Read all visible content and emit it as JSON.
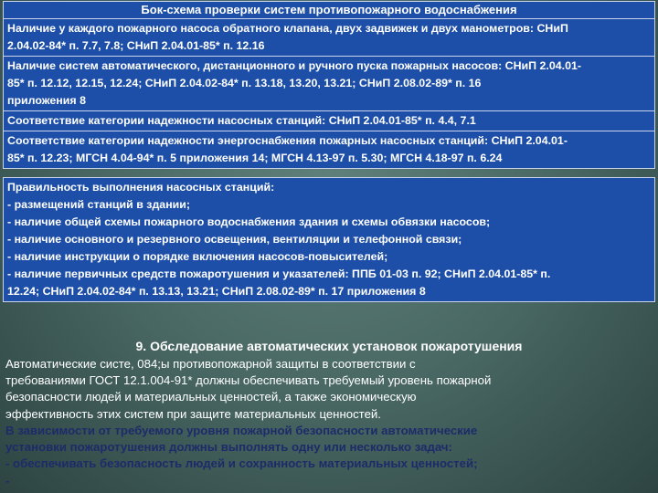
{
  "flowchart": {
    "title": "Бок-схема проверки систем противопожарного водоснабжения",
    "blocks": [
      {
        "lines": [
          "Наличие у каждого пожарного насоса обратного клапана, двух задвижек и двух манометров: СНиП",
          "2.04.02-84* п. 7.7, 7.8; СНиП 2.04.01-85* п. 12.16"
        ]
      },
      {
        "lines": [
          "Наличие систем автоматического, дистанционного и ручного пуска пожарных насосов: СНиП 2.04.01-",
          "85* п. 12.12, 12.15, 12.24; СНиП 2.04.02-84* п. 13.18, 13.20, 13.21; СНиП 2.08.02-89* п. 16",
          "приложения 8"
        ]
      },
      {
        "lines": [
          "Соответствие категории надежности насосных станций: СНиП 2.04.01-85* п. 4.4, 7.1"
        ]
      },
      {
        "lines": [
          "Соответствие категории надежности энергоснабжения пожарных насосных станций: СНиП 2.04.01-",
          "85* п. 12.23; МГСН 4.04-94* п. 5 приложения 14; МГСН 4.13-97 п. 5.30; МГСН 4.18-97 п. 6.24"
        ]
      },
      {
        "lines": [
          "Правильность выполнения насосных станций:",
          "- размещений станций в здании;",
          "- наличие общей схемы пожарного водоснабжения здания и схемы обвязки насосов;",
          "- наличие основного и резервного освещения, вентиляции и телефонной связи;",
          "- наличие инструкции о порядке включения насосов-повысителей;",
          "- наличие первичных средств пожаротушения и указателей: ППБ 01-03 п. 92; СНиП 2.04.01-85* п.",
          "12.24; СНиП 2.04.02-84* п. 13.13, 13.21; СНиП 2.08.02-89* п. 17 приложения 8"
        ]
      }
    ]
  },
  "section": {
    "title": "9. Обследование автоматических установок пожаротушения",
    "paragraph1": [
      " Автоматические систе, 084;ы противопожарной защиты в соответствии с",
      "требованиями ГОСТ 12.1.004-91* должны обеспечивать требуемый уровень пожарной",
      "безопасности людей и материальных ценностей, а также экономическую",
      "эффективность этих систем при защите материальных ценностей."
    ],
    "paragraph2": [
      "В зависимости от требуемого уровня пожарной безопасности автоматические",
      "установки пожаротушения должны выполнять одну или несколько задач:",
      "- обеспечивать безопасность людей и сохранность материальных ценностей;",
      "-"
    ]
  }
}
